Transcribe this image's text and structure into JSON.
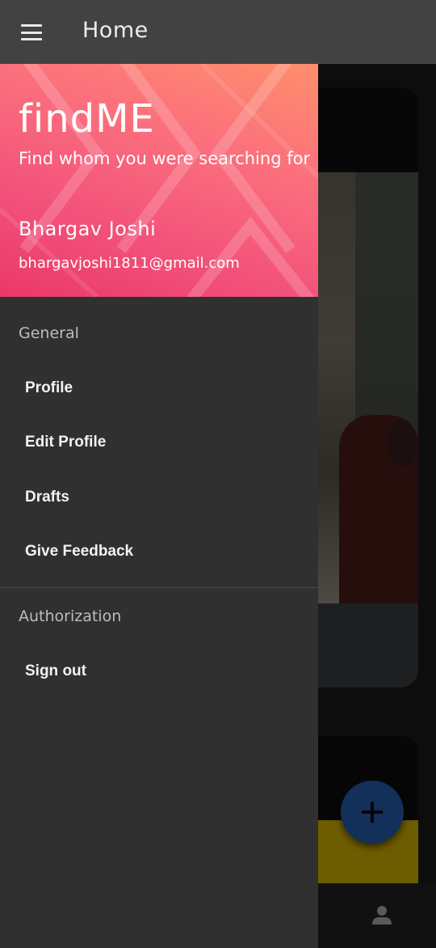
{
  "appbar": {
    "title": "Home",
    "menu_icon": "hamburger-menu-icon"
  },
  "drawer": {
    "header": {
      "app_name": "findME",
      "tagline": "Find whom you were searching for",
      "user_name": "Bhargav Joshi",
      "user_email": "bhargavjoshi1811@gmail.com",
      "gradient_colors": [
        "#ff8f6c",
        "#f2517a",
        "#ea3868"
      ]
    },
    "sections": [
      {
        "label": "General",
        "items": [
          {
            "label": "Profile"
          },
          {
            "label": "Edit Profile"
          },
          {
            "label": "Drafts"
          },
          {
            "label": "Give Feedback"
          }
        ]
      },
      {
        "label": "Authorization",
        "items": [
          {
            "label": "Sign out"
          }
        ]
      }
    ]
  },
  "background": {
    "fab_icon": "add-icon",
    "bottom_nav_icon": "person-icon",
    "fab_color": "#1d4a8a"
  }
}
